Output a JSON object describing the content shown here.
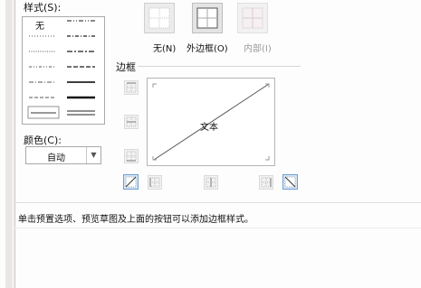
{
  "style": {
    "label": "样式(S):",
    "none_label": "无"
  },
  "color": {
    "label": "颜色(C):",
    "value": "自动"
  },
  "presets": {
    "none_label": "无(N)",
    "outline_label": "外边框(O)",
    "inside_label": "内部(I)"
  },
  "border": {
    "title": "边框",
    "preview_text": "文本"
  },
  "hint": "单击预置选项、预览草图及上面的按钮可以添加边框样式。"
}
